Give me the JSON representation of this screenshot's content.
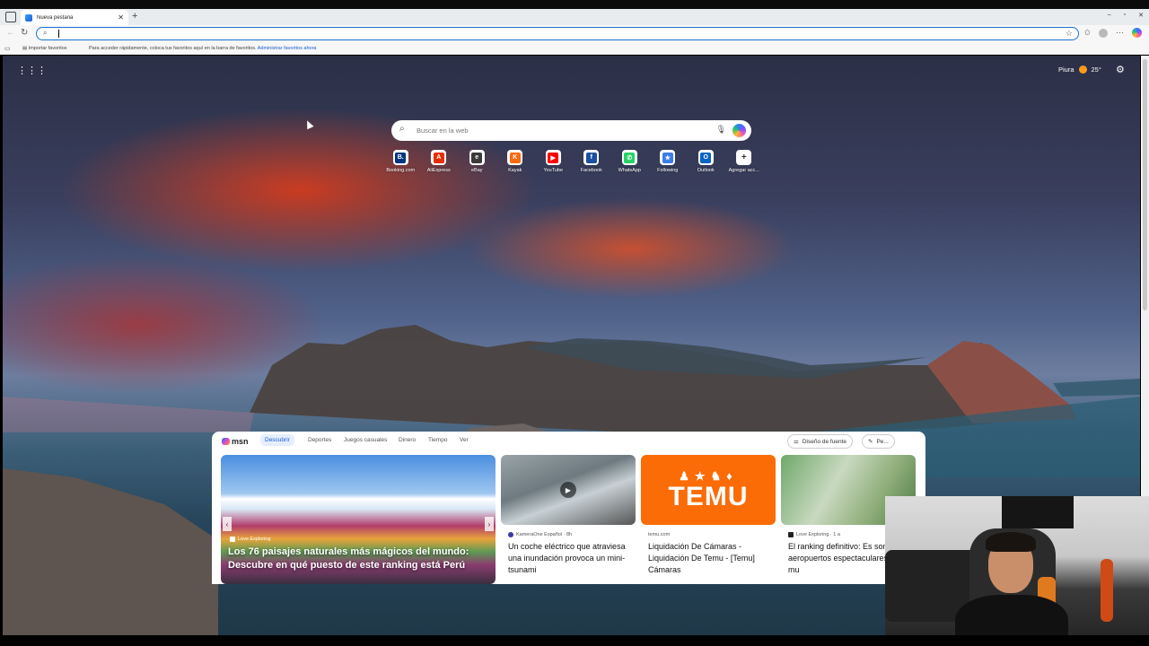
{
  "browser": {
    "tab_title": "Nueva pestaña",
    "window_controls": [
      "–",
      "▫",
      "✕"
    ],
    "favorites_bar": {
      "import_label": "Importar favoritos",
      "hint": "Para acceder rápidamente, coloca tus favoritos aquí en la barra de favoritos.",
      "manage_link": "Administrar favoritos ahora"
    }
  },
  "ntp": {
    "weather": {
      "location": "Piura",
      "temp": "25°"
    },
    "search_placeholder": "Buscar en la web",
    "quick_links": [
      {
        "label": "Booking.com",
        "letter": "B.",
        "color": "#003580",
        "icon": "booking-icon"
      },
      {
        "label": "AliExpress",
        "letter": "A",
        "color": "#e62e04",
        "icon": "aliexpress-icon"
      },
      {
        "label": "eBay",
        "letter": "e",
        "color": "#3a3a3a",
        "icon": "ebay-icon"
      },
      {
        "label": "Kayak",
        "letter": "K",
        "color": "#ff690f",
        "icon": "kayak-icon"
      },
      {
        "label": "YouTube",
        "letter": "▶",
        "color": "#ff0000",
        "icon": "youtube-icon"
      },
      {
        "label": "Facebook",
        "letter": "f",
        "color": "#1b4fa0",
        "icon": "facebook-icon"
      },
      {
        "label": "WhatsApp",
        "letter": "✆",
        "color": "#25d366",
        "icon": "whatsapp-icon"
      },
      {
        "label": "Following",
        "letter": "★",
        "color": "#3b7de8",
        "icon": "following-icon"
      },
      {
        "label": "Outlook",
        "letter": "O",
        "color": "#0a64c4",
        "icon": "outlook-icon"
      },
      {
        "label": "Agregar acc...",
        "letter": "+",
        "color": "#ffffff",
        "icon": "plus-icon"
      }
    ]
  },
  "feed": {
    "brand": "msn",
    "nav": [
      "Descubrir",
      "Deportes",
      "Juegos casuales",
      "Dinero",
      "Tiempo",
      "Ver"
    ],
    "active_nav": "Descubrir",
    "layout_button": "Diseño de fuente",
    "personalize_button": "Pe...",
    "big_card": {
      "source": "Love Exploring",
      "title": "Los 76 paisajes naturales más mágicos del mundo: Descubre en qué puesto de este ranking está Perú"
    },
    "cards": [
      {
        "source": "KameraOne Español · 8h",
        "title": "Un coche eléctrico que atraviesa una inundación provoca un mini- tsunami"
      },
      {
        "source": "temu.com",
        "title": "Liquidación De Cámaras - Liquidación De Temu - [Temu] Cámaras"
      },
      {
        "source": "Love Exploring · 1 a",
        "title": "El ranking definitivo: Es son los 14 aeropuertos espectaculares del mu"
      }
    ],
    "temu_brand": "TEMU"
  },
  "colors": {
    "accent": "#1a6fd1",
    "ntp_text": "#ffffff"
  }
}
